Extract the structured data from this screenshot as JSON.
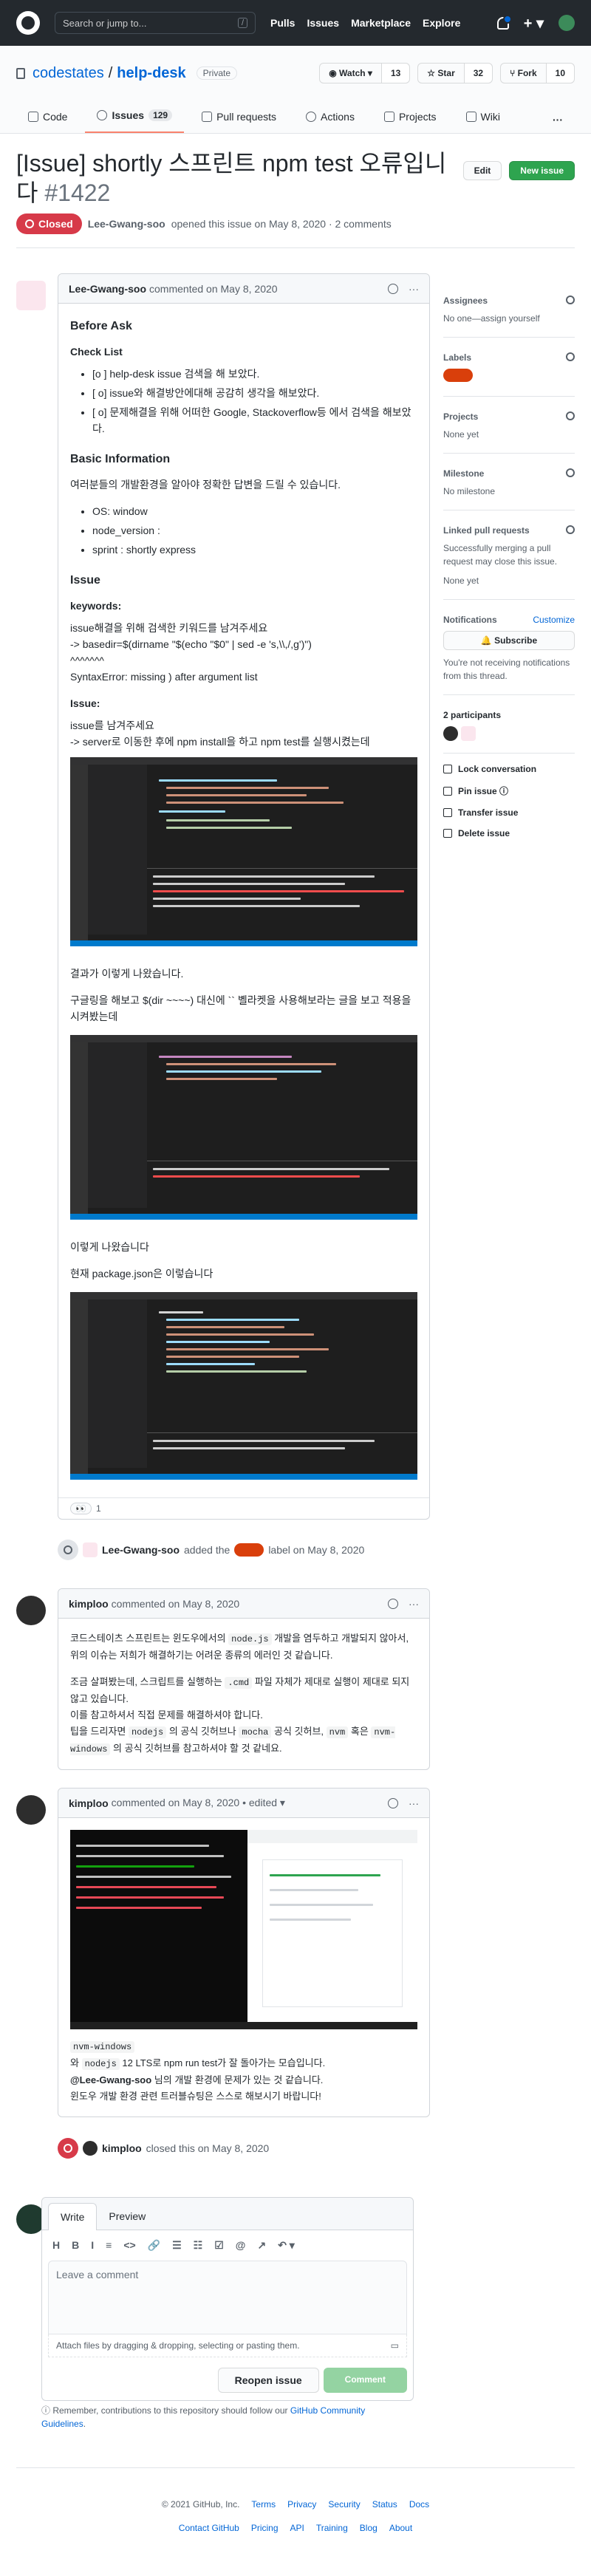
{
  "topbar": {
    "search_placeholder": "Search or jump to...",
    "slash": "/",
    "nav": [
      "Pulls",
      "Issues",
      "Marketplace",
      "Explore"
    ],
    "plus": "+ ▾"
  },
  "repo": {
    "owner": "codestates",
    "sep": "/",
    "name": "help-desk",
    "visibility": "Private",
    "watch": {
      "label": "◉ Watch ▾",
      "count": "13"
    },
    "star": {
      "label": "☆ Star",
      "count": "32"
    },
    "fork": {
      "label": "⑂ Fork",
      "count": "10"
    }
  },
  "tabs": [
    {
      "label": "Code"
    },
    {
      "label": "Issues",
      "count": "129"
    },
    {
      "label": "Pull requests"
    },
    {
      "label": "Actions"
    },
    {
      "label": "Projects"
    },
    {
      "label": "Wiki"
    }
  ],
  "tabs_more": "···",
  "issue": {
    "title": "[Issue] shortly 스프린트 npm test 오류입니다",
    "number": "#1422",
    "edit": "Edit",
    "new_issue": "New issue",
    "state": "Closed",
    "author": "Lee-Gwang-soo",
    "meta": "opened this issue on May 8, 2020 · 2 comments"
  },
  "comment1": {
    "author": "Lee-Gwang-soo",
    "meta": "commented on May 8, 2020",
    "more": "···",
    "before_ask": "Before Ask",
    "checklist_title": "Check List",
    "checklist": [
      "[o ] help-desk issue 검색을 해 보았다.",
      "[ o] issue와 해결방안에대해 공감히 생각을 해보았다.",
      "[ o] 문제해결을 위해 어떠한 Google, Stackoverflow등 에서 검색을 해보았다."
    ],
    "basic_title": "Basic Information",
    "basic_text": "여러분들의 개발환경을 알아야 정확한 답변을 드릴 수 있습니다.",
    "basic_list": [
      "OS: window",
      "node_version :",
      "sprint : shortly express"
    ],
    "issue_title": "Issue",
    "keywords_title": "keywords:",
    "kw_line1": "issue해결을 위해 검색한 키워드를 남겨주세요",
    "kw_line2": "-> basedir=$(dirname \"$(echo \"$0\" | sed -e 's,\\\\,/,g')\")",
    "kw_line3": "^^^^^^^",
    "kw_line4": "SyntaxError: missing ) after argument list",
    "issue_sub": "Issue:",
    "is_line1": "issue를 남겨주세요",
    "is_line2": "-> server로 이동한 후에 npm install을 하고 npm test를 실행시켰는데",
    "p_result": "결과가 이렇게 나왔습니다.",
    "p_google": "구글링을 해보고 $(dir ~~~~) 대신에 `` 볠라켓을 사용해보라는 글을 보고 적용을 시켜봤는데",
    "p_result2": "이렇게 나왔습니다",
    "p_pkg": "현재 package.json은 이렇습니다",
    "reaction": "👀",
    "reaction_count": "1"
  },
  "event_label": {
    "author": "Lee-Gwang-soo",
    "text1": "added the",
    "text2": "label on May 8, 2020"
  },
  "comment2": {
    "author": "kimploo",
    "meta": "commented on May 8, 2020",
    "more": "···",
    "p1_a": "코드스테이츠 스프린트는 윈도우에서의 ",
    "p1_code": "node.js",
    "p1_b": " 개발을 염두하고 개발되지 않아서, 위의 이슈는 저희가 해결하기는 어려운 종류의 에러인 것 같습니다.",
    "p2_a": "조금 살펴봤는데, 스크립트를 실행하는 ",
    "p2_code": ".cmd",
    "p2_b": " 파일 자체가 제대로 실행이 제대로 되지 않고 있습니다.",
    "p3": "이를 참고하셔서 직접 문제를 해결하셔야 합니다.",
    "p4_a": "팁을 드리자면 ",
    "p4_c1": "nodejs",
    "p4_b": " 의 공식 깃허브나 ",
    "p4_c2": "mocha",
    "p4_c": " 공식 깃허브, ",
    "p4_c3": "nvm",
    "p4_d": " 혹은 ",
    "p4_c4": "nvm-windows",
    "p4_e": " 의 공식 깃허브를 참고하셔야 할 것 같네요."
  },
  "comment3": {
    "author": "kimploo",
    "meta": "commented on May 8, 2020 • edited ▾",
    "more": "···",
    "l1_code": "nvm-windows",
    "l2_a": "와 ",
    "l2_code": "nodejs",
    "l2_b": " 12 LTS로 npm run test가 잘 돌아가는 모습입니다.",
    "l3_mention": "@Lee-Gwang-soo",
    "l3_b": " 님의 개발 환경에 문제가 있는 것 같습니다.",
    "l4": "윈도우 개발 환경 관련 트러블슈팅은 스스로 해보시기 바랍니다!"
  },
  "event_close": {
    "author": "kimploo",
    "text": "closed this on May 8, 2020"
  },
  "new_comment": {
    "write": "Write",
    "preview": "Preview",
    "tools": [
      "H",
      "B",
      "I",
      "≡",
      "<>",
      "🔗",
      "☰",
      "☷",
      "☑",
      "@",
      "↗",
      "↶ ▾"
    ],
    "placeholder": "Leave a comment",
    "attach": "Attach files by dragging & dropping, selecting or pasting them.",
    "reopen": "Reopen issue",
    "comment": "Comment"
  },
  "remember": {
    "text": "Remember, contributions to this repository should follow our ",
    "link": "GitHub Community Guidelines",
    "end": "."
  },
  "sidebar": {
    "assignees_title": "Assignees",
    "assignees_value": "No one—assign yourself",
    "labels_title": "Labels",
    "projects_title": "Projects",
    "projects_value": "None yet",
    "milestone_title": "Milestone",
    "milestone_value": "No milestone",
    "linked_title": "Linked pull requests",
    "linked_value": "Successfully merging a pull request may close this issue.",
    "linked_value2": "None yet",
    "notifications_title": "Notifications",
    "customize": "Customize",
    "subscribe": "🔔 Subscribe",
    "not_receiving": "You're not receiving notifications from this thread.",
    "participants": "2 participants",
    "lock": "Lock conversation",
    "pin": "Pin issue ⓘ",
    "transfer": "Transfer issue",
    "delete": "Delete issue"
  },
  "footer": {
    "copy": "© 2021 GitHub, Inc.",
    "row1": [
      "Terms",
      "Privacy",
      "Security",
      "Status",
      "Docs"
    ],
    "row2": [
      "Contact GitHub",
      "Pricing",
      "API",
      "Training",
      "Blog",
      "About"
    ]
  },
  "colors": {
    "closed": "#d73a49",
    "label": "#d93f0b",
    "new_issue": "#2ea44f"
  }
}
